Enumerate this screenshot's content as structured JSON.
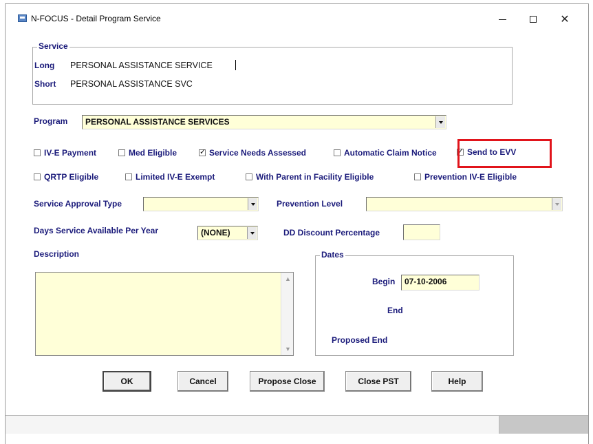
{
  "window": {
    "title": "N-FOCUS - Detail Program Service"
  },
  "service": {
    "legend": "Service",
    "long_label": "Long",
    "long_value": "PERSONAL ASSISTANCE SERVICE",
    "short_label": "Short",
    "short_value": "PERSONAL ASSISTANCE SVC"
  },
  "program": {
    "label": "Program",
    "value": "PERSONAL ASSISTANCE SERVICES"
  },
  "checkboxes_row1": [
    {
      "label": "IV-E Payment",
      "checked": false
    },
    {
      "label": "Med Eligible",
      "checked": false
    },
    {
      "label": "Service Needs Assessed",
      "checked": true
    },
    {
      "label": "Automatic Claim Notice",
      "checked": false
    },
    {
      "label": "Send to EVV",
      "checked": true
    }
  ],
  "checkboxes_row2": [
    {
      "label": "QRTP Eligible",
      "checked": false
    },
    {
      "label": "Limited IV-E Exempt",
      "checked": false
    },
    {
      "label": "With Parent in Facility Eligible",
      "checked": false
    },
    {
      "label": "Prevention IV-E Eligible",
      "checked": false
    }
  ],
  "approval": {
    "label": "Service Approval Type",
    "value": ""
  },
  "prevention": {
    "label": "Prevention Level",
    "value": ""
  },
  "days": {
    "label": "Days Service Available Per Year",
    "value": "(NONE)"
  },
  "dd_discount": {
    "label": "DD Discount Percentage",
    "value": ""
  },
  "description": {
    "label": "Description",
    "value": ""
  },
  "dates": {
    "legend": "Dates",
    "begin_label": "Begin",
    "begin_value": "07-10-2006",
    "end_label": "End",
    "proposed_end_label": "Proposed End"
  },
  "buttons": {
    "ok": "OK",
    "cancel": "Cancel",
    "propose_close": "Propose Close",
    "close_pst": "Close PST",
    "help": "Help"
  },
  "colors": {
    "field_bg": "#ffffd8",
    "label": "#1a1a7a",
    "highlight": "#e1141b"
  }
}
